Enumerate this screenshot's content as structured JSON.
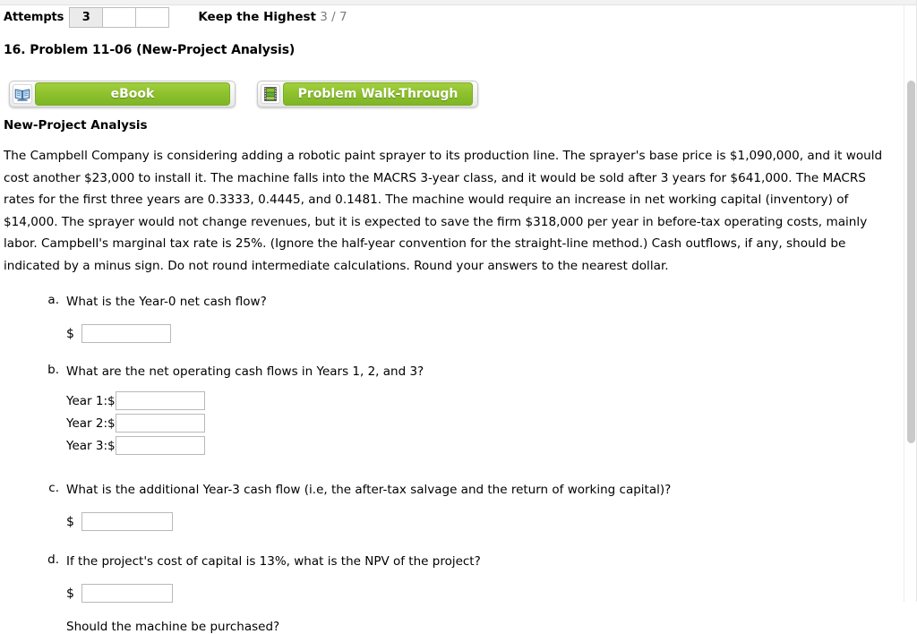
{
  "header": {
    "attempts_label": "Attempts",
    "attempt_cells": [
      "3",
      "",
      ""
    ],
    "keep_highest_label": "Keep the Highest",
    "keep_highest_score": "3 / 7"
  },
  "problem": {
    "title": "16.  Problem 11-06 (New-Project Analysis)",
    "section_heading": "New-Project Analysis",
    "body": "The Campbell Company is considering adding a robotic paint sprayer to its production line. The sprayer's base price is $1,090,000, and it would cost another $23,000 to install it. The machine falls into the MACRS 3-year class, and it would be sold after 3 years for $641,000. The MACRS rates for the first three years are 0.3333, 0.4445, and 0.1481. The machine would require an increase in net working capital (inventory) of $14,000. The sprayer would not change revenues, but it is expected to save the firm $318,000 per year in before-tax operating costs, mainly labor. Campbell's marginal tax rate is 25%. (Ignore the half-year convention for the straight-line method.) Cash outflows, if any, should be indicated by a minus sign. Do not round intermediate calculations. Round your answers to the nearest dollar."
  },
  "buttons": {
    "ebook": {
      "label": "eBook",
      "icon": "book-icon"
    },
    "walkthrough": {
      "label": "Problem Walk-Through",
      "icon": "film-strip-icon"
    }
  },
  "questions": [
    {
      "marker": "a.",
      "text": "What is the Year-0 net cash flow?",
      "dollar": "$",
      "value": "",
      "placeholder": ""
    },
    {
      "marker": "b.",
      "text": "What are the net operating cash flows in Years 1, 2, and 3?",
      "years": [
        {
          "label": "Year 1:$",
          "value": "",
          "placeholder": ""
        },
        {
          "label": "Year 2:$",
          "value": "",
          "placeholder": ""
        },
        {
          "label": "Year 3:$",
          "value": "",
          "placeholder": ""
        }
      ]
    },
    {
      "marker": "c.",
      "text": "What is the additional Year-3 cash flow (i.e, the after-tax salvage and the return of working capital)?",
      "dollar": "$",
      "value": "",
      "placeholder": ""
    },
    {
      "marker": "d.",
      "text": "If the project's cost of capital is 13%, what is the NPV of the project?",
      "dollar": "$",
      "value": "",
      "placeholder": "",
      "follow_up": "Should the machine be purchased?"
    }
  ],
  "colors": {
    "button_green": "#8cc02c",
    "attempt_fill": "#ebebeb",
    "score_gray": "#7d7d7d",
    "scrollbar_thumb": "#c9c9c9"
  }
}
